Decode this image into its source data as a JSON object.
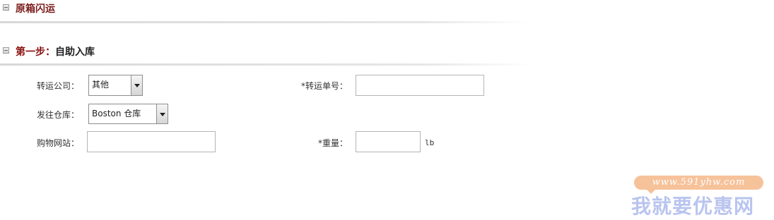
{
  "sections": {
    "origin_box": {
      "title": "原箱闪运"
    },
    "step1": {
      "step_label": "第一步：",
      "title": "自助入库"
    }
  },
  "form": {
    "carrier": {
      "label": "转运公司：",
      "value": "其他"
    },
    "tracking": {
      "label": "*转运单号：",
      "value": ""
    },
    "warehouse": {
      "label": "发往仓库：",
      "value": "Boston 仓库"
    },
    "shop_site": {
      "label": "购物网站：",
      "value": ""
    },
    "weight": {
      "label": "*重量：",
      "value": "",
      "unit": "lb"
    }
  },
  "watermark": {
    "url": "www.591yhw.com",
    "text": "我就要优惠网",
    "colors": {
      "pill": "#f6c29a",
      "text": "#b9c4ef"
    }
  },
  "colors": {
    "section_title": "#7a1a1a",
    "step_label": "#8a1010"
  }
}
